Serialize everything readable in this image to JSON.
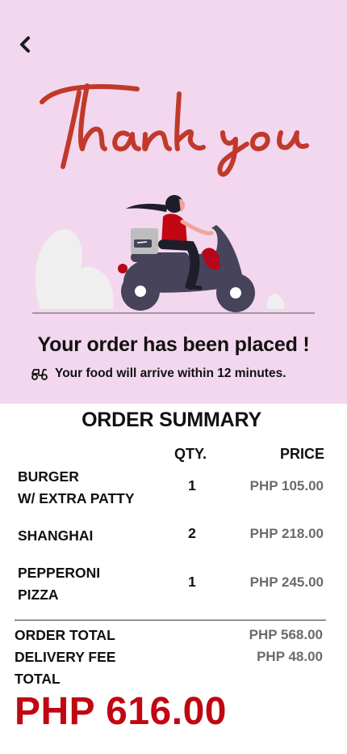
{
  "header": {
    "back_icon": "chevron-left-icon",
    "thank_you_text": "Thank you"
  },
  "confirmation": {
    "title": "Your order has been placed !",
    "eta_icon": "scooter-icon",
    "eta_text": "Your food will arrive within 12 minutes."
  },
  "summary": {
    "title": "ORDER SUMMARY",
    "qty_header": "QTY.",
    "price_header": "PRICE",
    "items": [
      {
        "name_line1": "BURGER",
        "name_line2": "W/ EXTRA PATTY",
        "qty": "1",
        "price": "PHP 105.00"
      },
      {
        "name_line1": "SHANGHAI",
        "name_line2": "",
        "qty": "2",
        "price": "PHP 218.00"
      },
      {
        "name_line1": "PEPPERONI",
        "name_line2": "PIZZA",
        "qty": "1",
        "price": "PHP 245.00"
      }
    ]
  },
  "totals": {
    "order_total_label": "ORDER TOTAL",
    "order_total_value": "PHP 568.00",
    "delivery_fee_label": "DELIVERY FEE",
    "delivery_fee_value": "PHP 48.00",
    "total_label": "TOTAL",
    "grand_total": "PHP 616.00"
  },
  "colors": {
    "hero_bg": "#f3d7ee",
    "accent_red": "#c00712",
    "script_red": "#c1392b",
    "scooter": "#46435a"
  }
}
